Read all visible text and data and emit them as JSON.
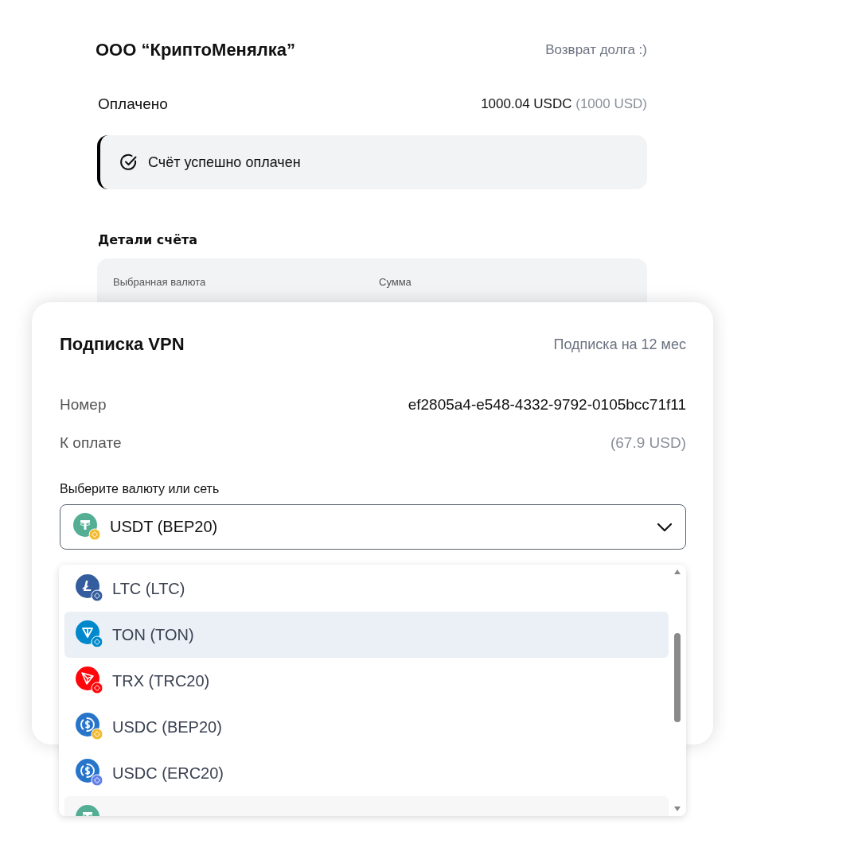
{
  "merchant": {
    "name": "ООО “КриптоМенялка”",
    "purpose": "Возврат долга :)"
  },
  "paid": {
    "label": "Оплачено",
    "amount": "1000.04 USDC",
    "amount_usd": "(1000 USD)"
  },
  "alert": {
    "text": "Счёт успешно оплачен"
  },
  "details": {
    "title": "Детали счёта",
    "columns": [
      "Выбранная валюта",
      "Сумма"
    ]
  },
  "invoice": {
    "title": "Подписка VPN",
    "subtitle": "Подписка на 12 мес",
    "rows": [
      {
        "label": "Номер",
        "value": "ef2805a4-e548-4332-9792-0105bcc71f11",
        "muted": false
      },
      {
        "label": "К оплате",
        "value": "(67.9 USD)",
        "muted": true
      }
    ],
    "select_label": "Выберите валюту или сеть",
    "select": {
      "kind": "usdt",
      "color": "#f3ba2f",
      "value": "USDT (BEP20)",
      "expanded": true
    },
    "options": [
      {
        "kind": "ltc",
        "color": "#345d9d",
        "label": "LTC (LTC)",
        "selected": false
      },
      {
        "kind": "ton",
        "color": "#0088cc",
        "label": "TON (TON)",
        "selected": true
      },
      {
        "kind": "trx",
        "color": "#ff060a",
        "label": "TRX (TRC20)",
        "selected": false
      },
      {
        "kind": "usdc",
        "color": "#f3ba2f",
        "label": "USDC (BEP20)",
        "selected": false
      },
      {
        "kind": "usdc",
        "color": "#627eea",
        "label": "USDC (ERC20)",
        "selected": false
      },
      {
        "kind": "usdt",
        "selected": false,
        "hovered": true
      }
    ]
  }
}
